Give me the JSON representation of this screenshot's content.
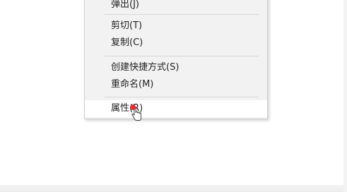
{
  "context_menu": {
    "items": [
      {
        "label": "弹出(J)"
      },
      {
        "label": "剪切(T)"
      },
      {
        "label": "复制(C)"
      },
      {
        "label": "创建快捷方式(S)"
      },
      {
        "label": "重命名(M)"
      },
      {
        "label": "属性(R)",
        "state": "hover"
      }
    ]
  },
  "colors": {
    "menu_background": "#f2f2f2",
    "menu_hover": "#ffffff",
    "click_marker": "#e8262b"
  },
  "icons": {
    "cursor": "hand-pointer-icon",
    "click_marker": "red-dot-marker-icon"
  }
}
